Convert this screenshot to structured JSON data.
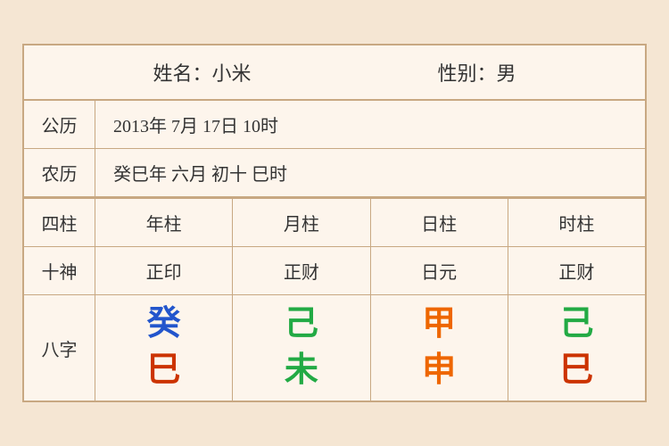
{
  "header": {
    "name_label": "姓名：小米",
    "gender_label": "性别：男"
  },
  "rows": {
    "gregorian_label": "公历",
    "gregorian_value": "2013年 7月 17日 10时",
    "lunar_label": "农历",
    "lunar_value": "癸巳年 六月 初十 巳时"
  },
  "table": {
    "sizhus_label": "四柱",
    "shishen_label": "十神",
    "bazi_label": "八字",
    "columns": [
      {
        "sizhu": "年柱",
        "shishen": "正印",
        "top_char": "癸",
        "top_color": "#2255cc",
        "bottom_char": "巳",
        "bottom_color": "#cc3300"
      },
      {
        "sizhu": "月柱",
        "shishen": "正财",
        "top_char": "己",
        "top_color": "#22aa44",
        "bottom_char": "未",
        "bottom_color": "#22aa44"
      },
      {
        "sizhu": "日柱",
        "shishen": "日元",
        "top_char": "甲",
        "top_color": "#ee6600",
        "bottom_char": "申",
        "bottom_color": "#ee6600"
      },
      {
        "sizhu": "时柱",
        "shishen": "正财",
        "top_char": "己",
        "top_color": "#22aa44",
        "bottom_char": "巳",
        "bottom_color": "#cc3300"
      }
    ]
  }
}
